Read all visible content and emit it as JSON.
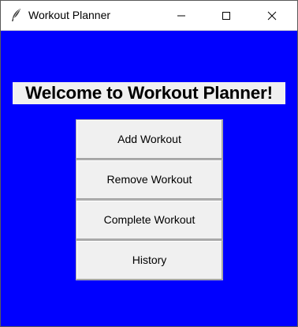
{
  "window": {
    "title": "Workout Planner",
    "app_icon": "feather-icon",
    "controls": [
      "minimize-icon",
      "maximize-icon",
      "close-icon"
    ]
  },
  "main": {
    "background_color": "#0000ff",
    "heading": "Welcome to Workout Planner!",
    "buttons": [
      {
        "label": "Add Workout"
      },
      {
        "label": "Remove Workout"
      },
      {
        "label": "Complete Workout"
      },
      {
        "label": "History"
      }
    ]
  }
}
